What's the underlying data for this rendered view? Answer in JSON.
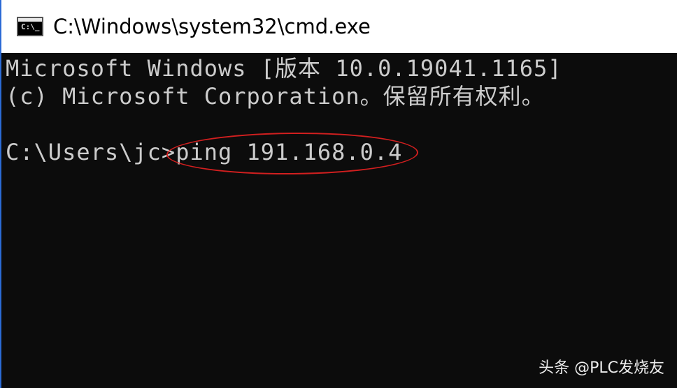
{
  "window": {
    "title": "C:\\Windows\\system32\\cmd.exe",
    "icon": "cmd-icon",
    "icon_glyph": "C:\\_"
  },
  "console": {
    "lines": [
      "Microsoft Windows [版本 10.0.19041.1165]",
      "(c) Microsoft Corporation。保留所有权利。",
      ""
    ],
    "prompt": "C:\\Users\\jc>",
    "command": "ping 191.168.0.4"
  },
  "annotation": {
    "type": "red-ellipse",
    "color": "#d21f1f"
  },
  "watermark": {
    "text": "头条 @PLC发烧友"
  },
  "colors": {
    "console_bg": "#0c0c0c",
    "console_fg": "#cccccc",
    "titlebar_bg": "#ffffff",
    "window_border": "#2b6bd6"
  }
}
